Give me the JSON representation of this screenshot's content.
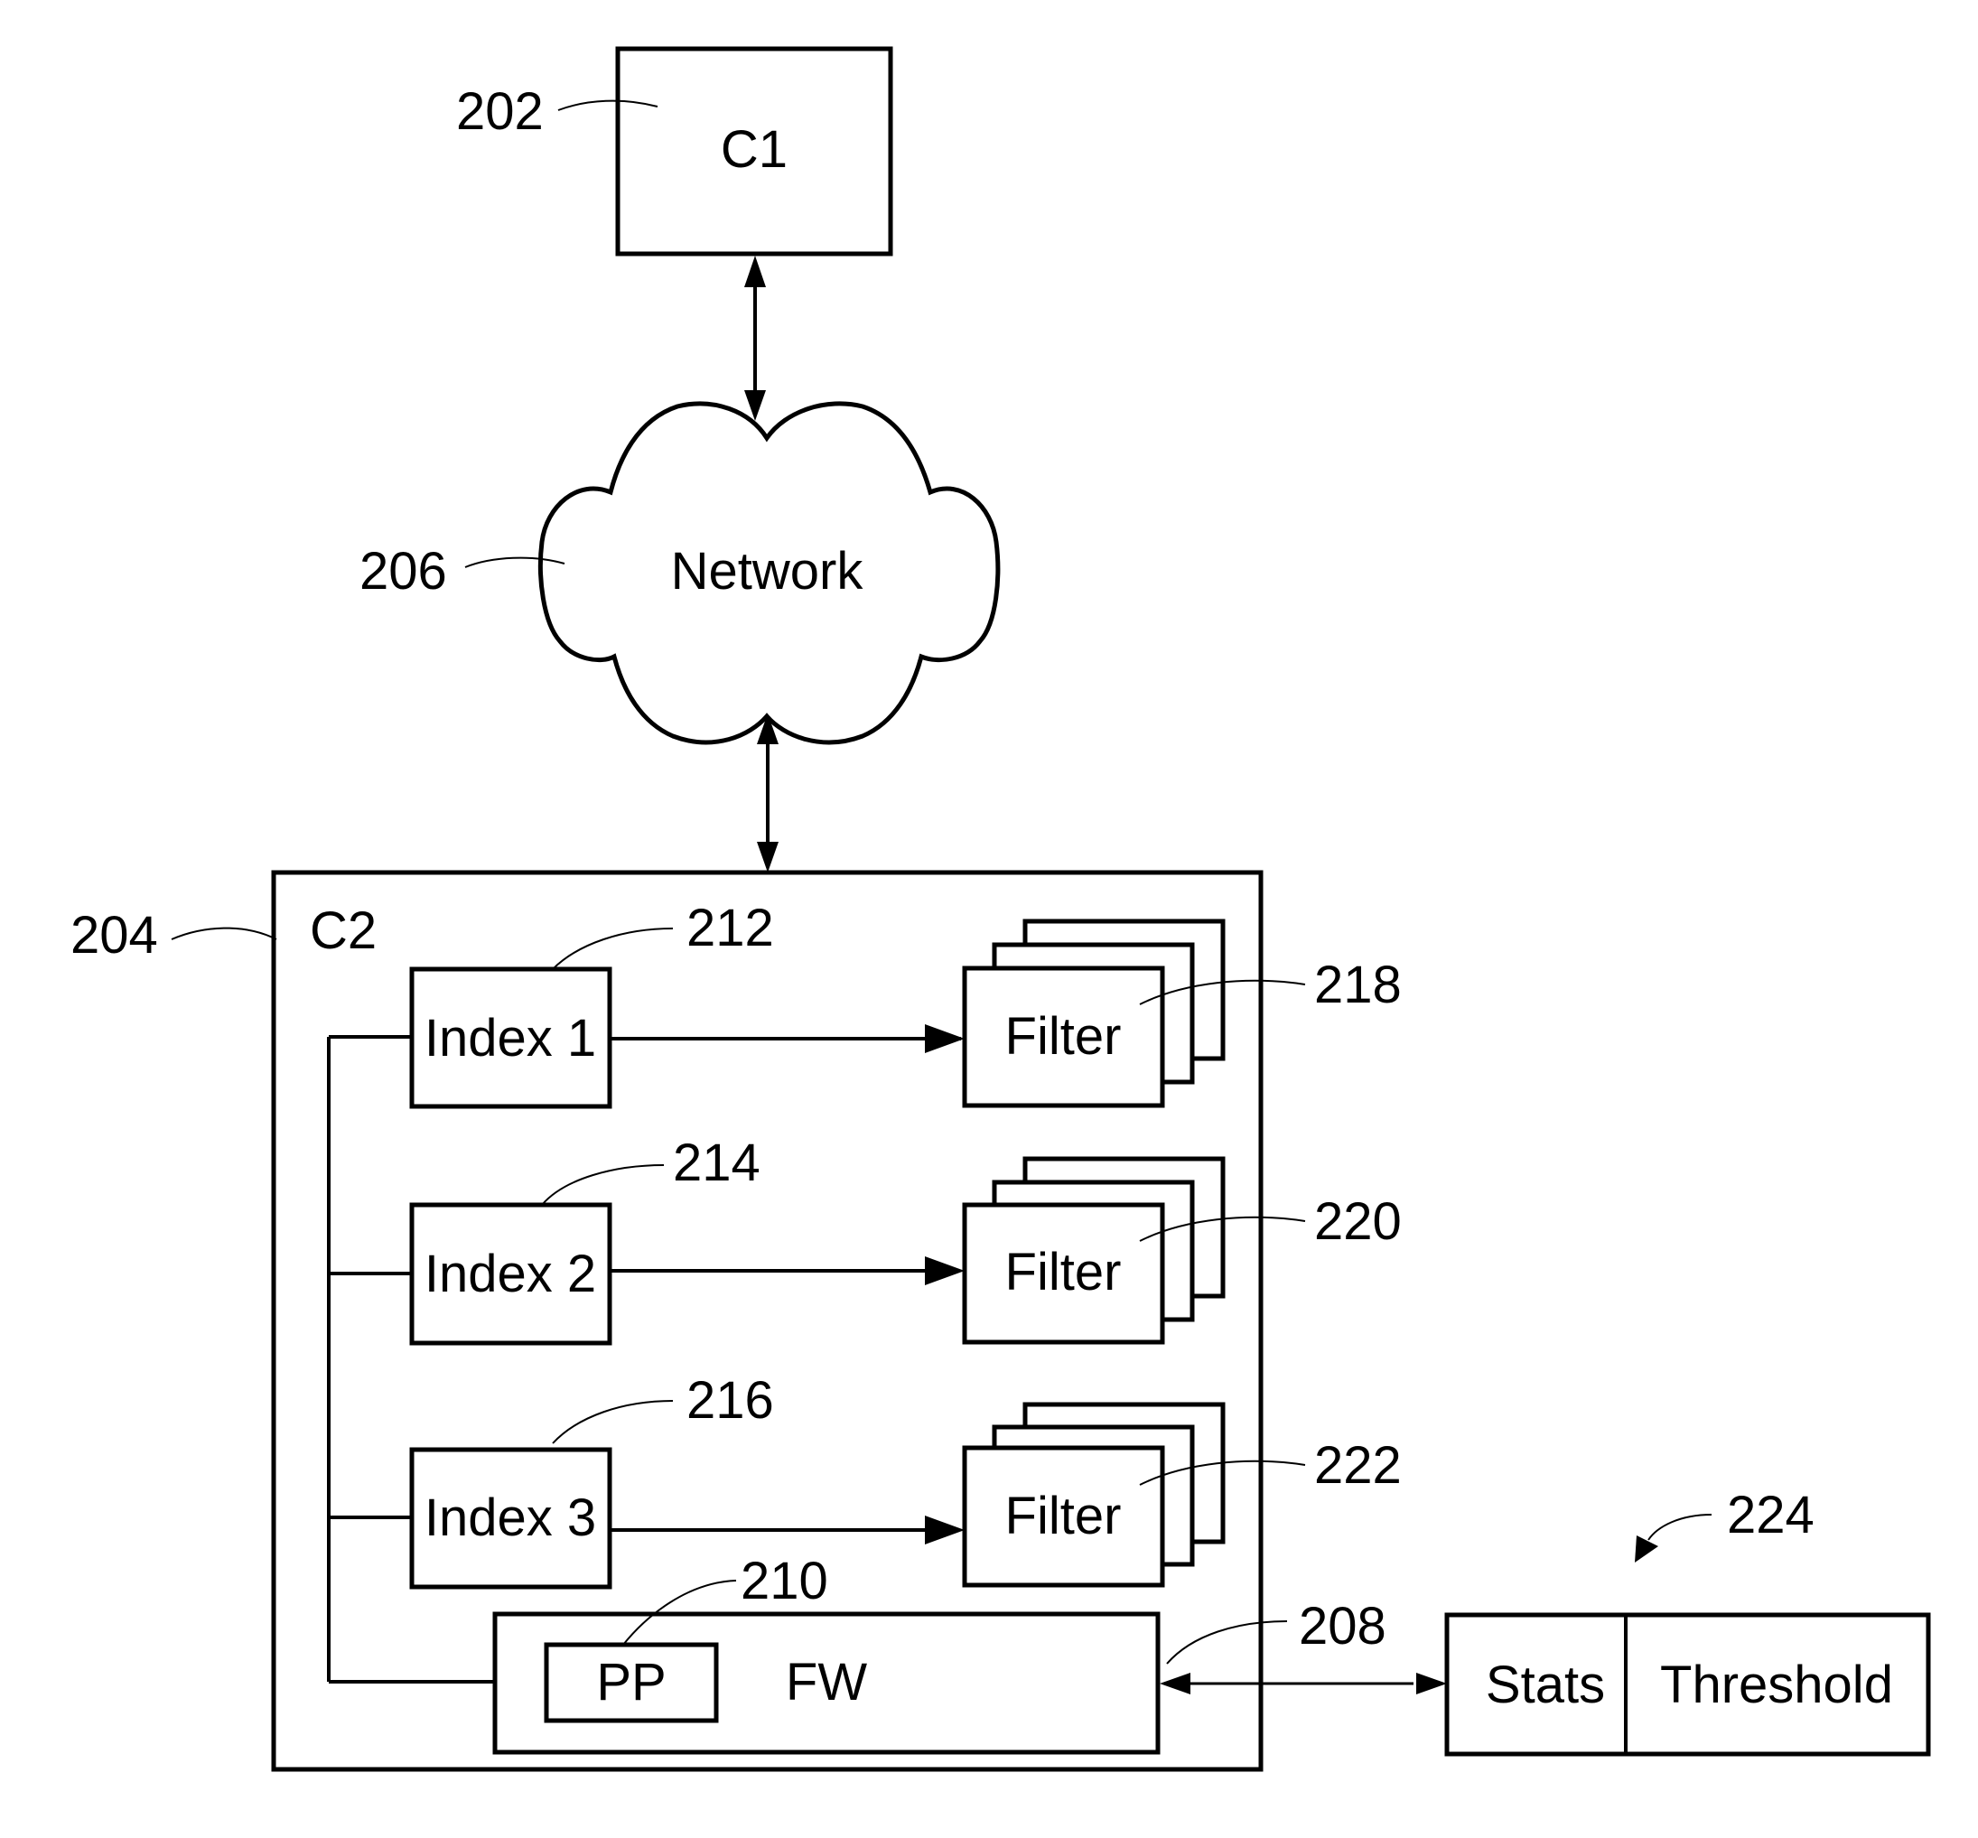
{
  "figure": {
    "nodes": {
      "c1": {
        "label": "C1",
        "ref": "202"
      },
      "network": {
        "label": "Network",
        "ref": "206"
      },
      "c2": {
        "label": "C2",
        "ref": "204"
      },
      "index1": {
        "label": "Index 1",
        "ref": "212"
      },
      "index2": {
        "label": "Index 2",
        "ref": "214"
      },
      "index3": {
        "label": "Index 3",
        "ref": "216"
      },
      "filter1": {
        "label": "Filter",
        "ref": "218"
      },
      "filter2": {
        "label": "Filter",
        "ref": "220"
      },
      "filter3": {
        "label": "Filter",
        "ref": "222"
      },
      "fw": {
        "label": "FW",
        "ref": "208"
      },
      "pp": {
        "label": "PP",
        "ref": "210"
      },
      "stats": {
        "label": "Stats"
      },
      "threshold": {
        "label": "Threshold"
      },
      "stats_threshold_group": {
        "ref": "224"
      }
    },
    "edges": [
      {
        "from": "c1",
        "to": "network",
        "direction": "bidirectional"
      },
      {
        "from": "network",
        "to": "c2",
        "direction": "bidirectional"
      },
      {
        "from": "index1",
        "to": "filter1",
        "direction": "forward"
      },
      {
        "from": "index2",
        "to": "filter2",
        "direction": "forward"
      },
      {
        "from": "index3",
        "to": "filter3",
        "direction": "forward"
      },
      {
        "from": "fw",
        "to": "index1",
        "direction": "bus"
      },
      {
        "from": "fw",
        "to": "index2",
        "direction": "bus"
      },
      {
        "from": "fw",
        "to": "index3",
        "direction": "bus"
      },
      {
        "from": "fw",
        "to": "stats",
        "direction": "bidirectional"
      }
    ]
  }
}
